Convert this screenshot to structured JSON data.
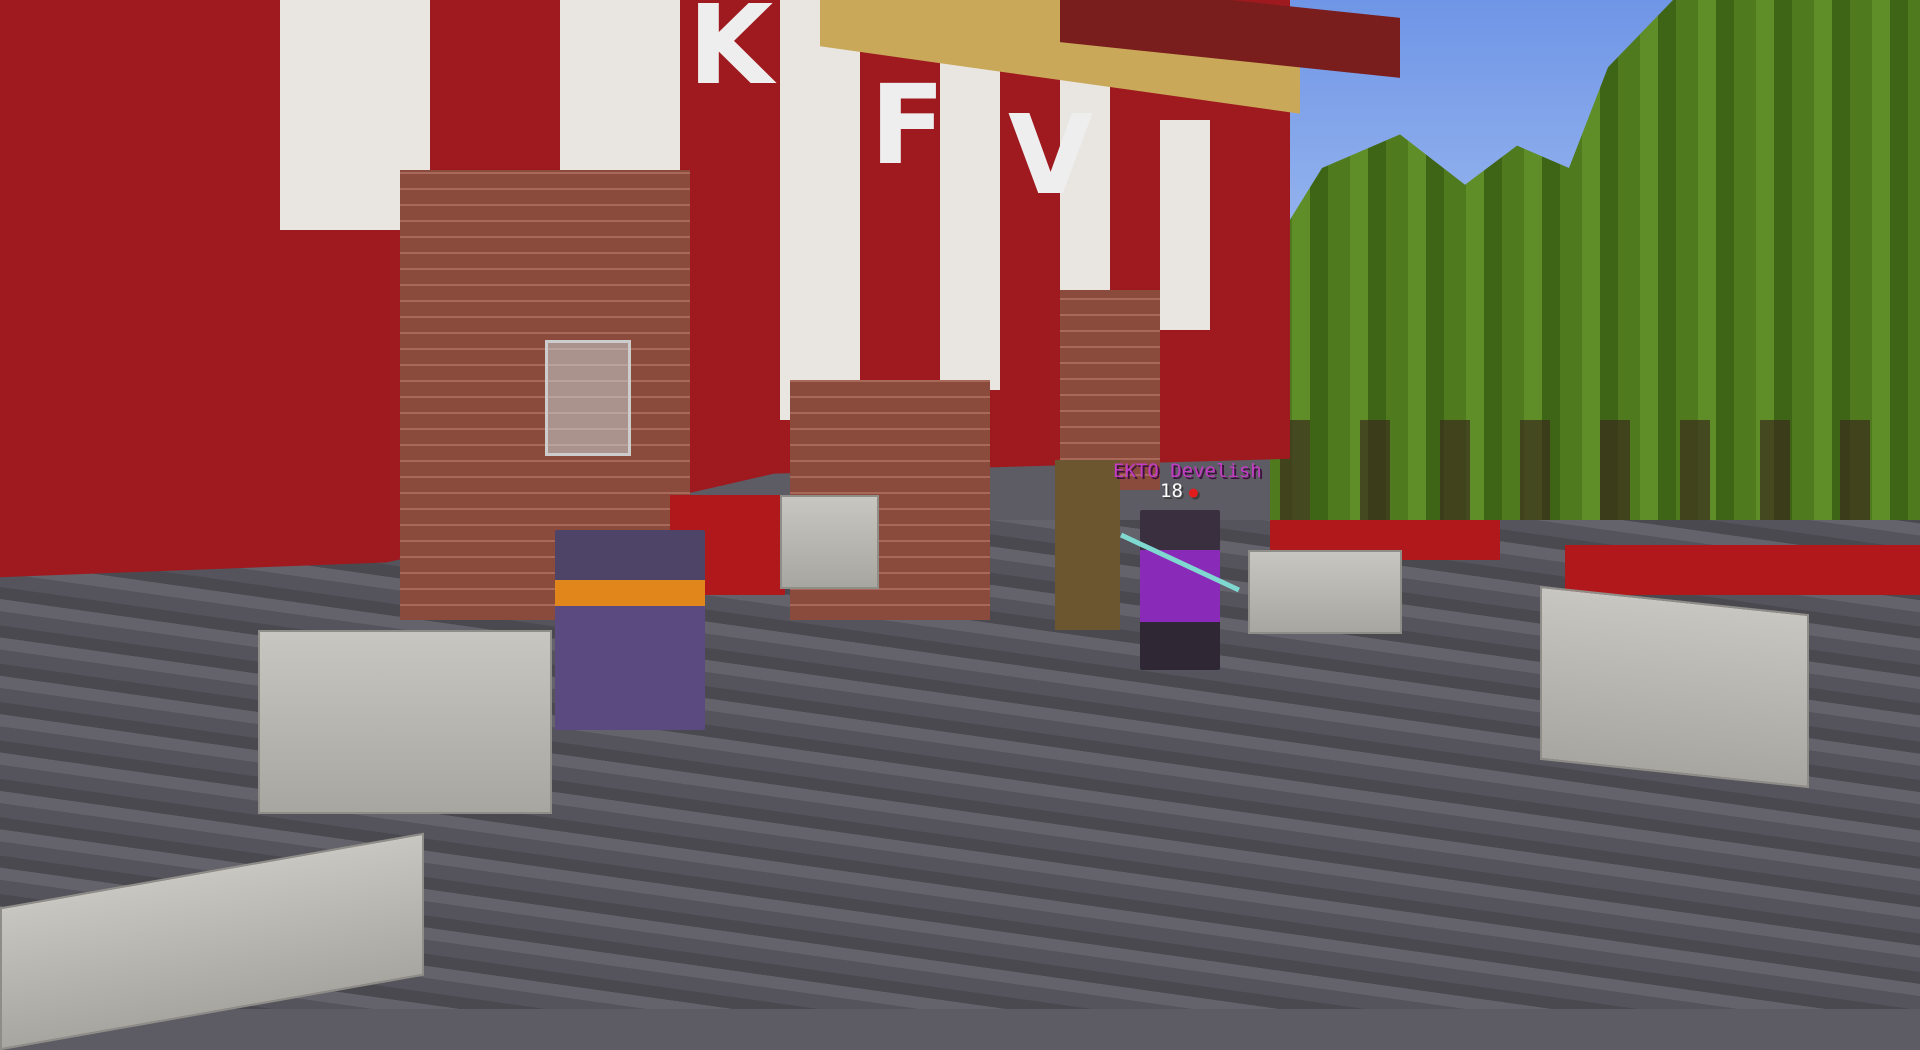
{
  "scene": {
    "sign_letters": [
      "K",
      "F",
      "V"
    ]
  },
  "nametag": {
    "name": "EKTO Develish",
    "health": "18",
    "name_color": "#c43cc4",
    "health_icon": "heart-icon"
  }
}
